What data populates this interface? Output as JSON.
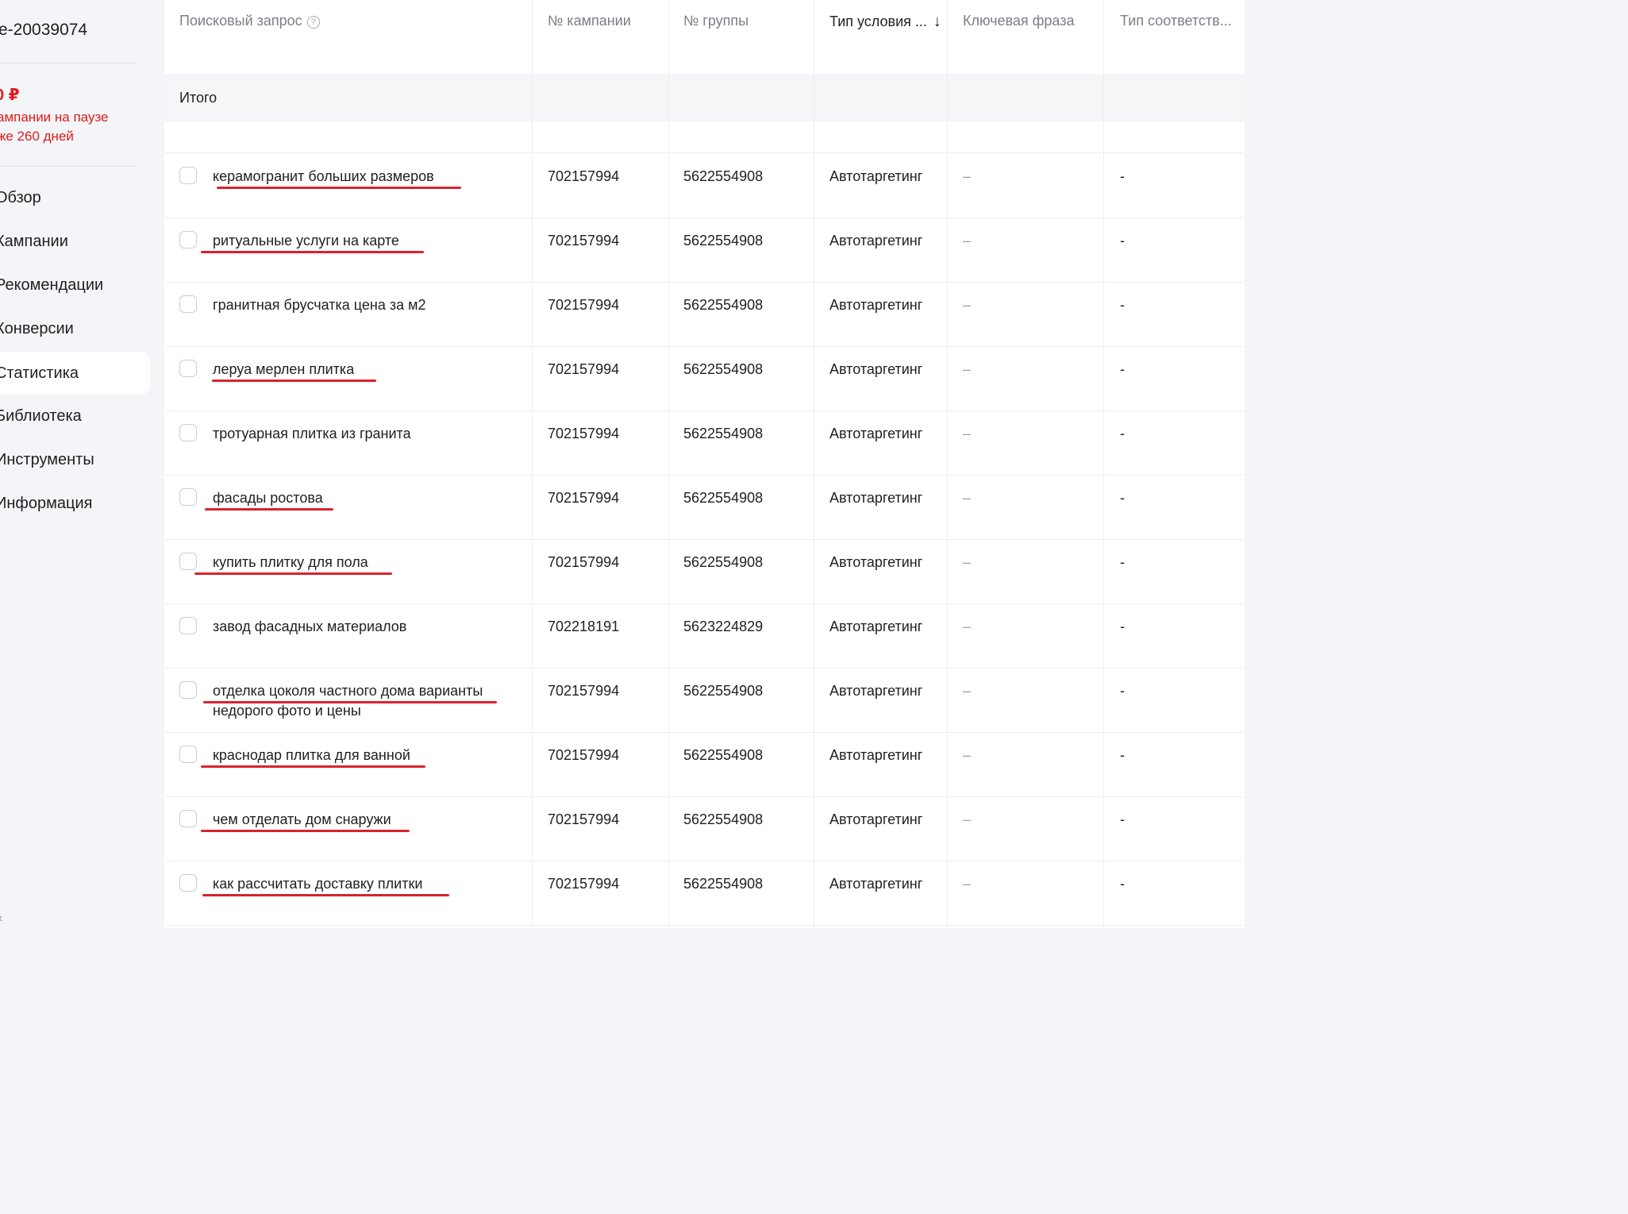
{
  "sidebar": {
    "account": "e-20039074",
    "balance": "0 ₽",
    "warning": "ампании на паузе\nже 260 дней",
    "items": [
      {
        "label": "Обзор",
        "active": false
      },
      {
        "label": "Кампании",
        "active": false
      },
      {
        "label": "Рекомендации",
        "active": false
      },
      {
        "label": "Конверсии",
        "active": false
      },
      {
        "label": "Статистика",
        "active": true
      },
      {
        "label": "Библиотека",
        "active": false
      },
      {
        "label": "Инструменты",
        "active": false
      },
      {
        "label": "Информация",
        "active": false
      }
    ]
  },
  "table": {
    "headers": {
      "query": "Поисковый запрос",
      "campaign": "№ кампании",
      "group": "№ группы",
      "condition": "Тип условия ...",
      "keyword": "Ключевая фраза",
      "match": "Тип соответств..."
    },
    "total_label": "Итого",
    "rows": [
      {
        "query": "керамогранит больших размеров",
        "campaign": "702157994",
        "group": "5622554908",
        "type": "Автотаргетинг",
        "keyword": "–",
        "match": "-",
        "underlined": true
      },
      {
        "query": "ритуальные услуги на карте",
        "campaign": "702157994",
        "group": "5622554908",
        "type": "Автотаргетинг",
        "keyword": "–",
        "match": "-",
        "underlined": true
      },
      {
        "query": "гранитная брусчатка цена за м2",
        "campaign": "702157994",
        "group": "5622554908",
        "type": "Автотаргетинг",
        "keyword": "–",
        "match": "-",
        "underlined": false
      },
      {
        "query": "леруа мерлен плитка",
        "campaign": "702157994",
        "group": "5622554908",
        "type": "Автотаргетинг",
        "keyword": "–",
        "match": "-",
        "underlined": true
      },
      {
        "query": "тротуарная плитка из гранита",
        "campaign": "702157994",
        "group": "5622554908",
        "type": "Автотаргетинг",
        "keyword": "–",
        "match": "-",
        "underlined": false
      },
      {
        "query": "фасады ростова",
        "campaign": "702157994",
        "group": "5622554908",
        "type": "Автотаргетинг",
        "keyword": "–",
        "match": "-",
        "underlined": true
      },
      {
        "query": "купить плитку для пола",
        "campaign": "702157994",
        "group": "5622554908",
        "type": "Автотаргетинг",
        "keyword": "–",
        "match": "-",
        "underlined": true
      },
      {
        "query": "завод фасадных материалов",
        "campaign": "702218191",
        "group": "5623224829",
        "type": "Автотаргетинг",
        "keyword": "–",
        "match": "-",
        "underlined": false
      },
      {
        "query": "отделка цоколя частного дома варианты недорого фото и цены",
        "campaign": "702157994",
        "group": "5622554908",
        "type": "Автотаргетинг",
        "keyword": "–",
        "match": "-",
        "underlined": true
      },
      {
        "query": "краснодар плитка для ванной",
        "campaign": "702157994",
        "group": "5622554908",
        "type": "Автотаргетинг",
        "keyword": "–",
        "match": "-",
        "underlined": true
      },
      {
        "query": "чем отделать дом снаружи",
        "campaign": "702157994",
        "group": "5622554908",
        "type": "Автотаргетинг",
        "keyword": "–",
        "match": "-",
        "underlined": true
      },
      {
        "query": "как рассчитать доставку плитки",
        "campaign": "702157994",
        "group": "5622554908",
        "type": "Автотаргетинг",
        "keyword": "–",
        "match": "-",
        "underlined": true
      }
    ]
  },
  "colors": {
    "underline": "#d9232d",
    "warning": "#e01b1b"
  }
}
